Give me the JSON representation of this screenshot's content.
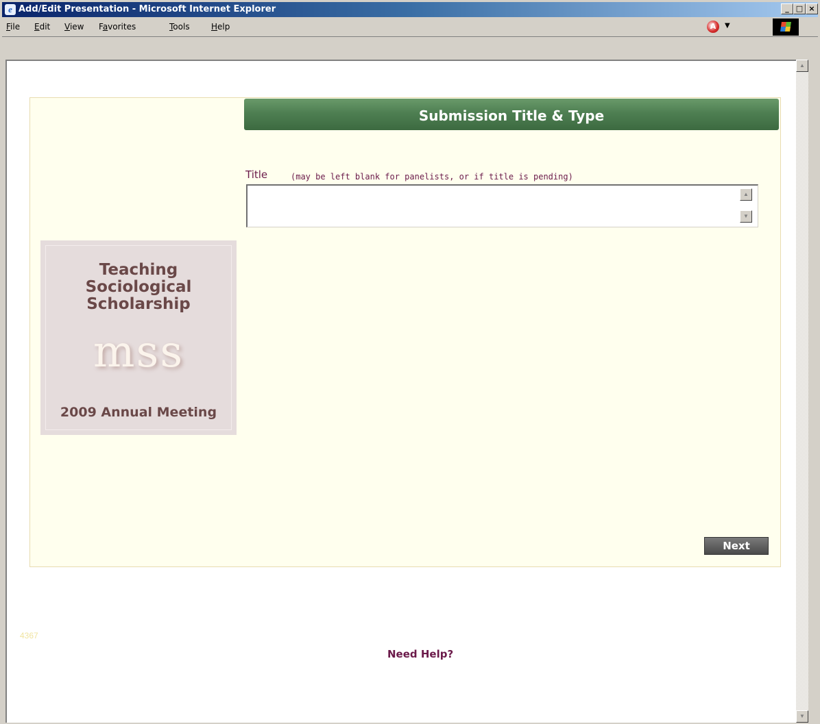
{
  "window": {
    "title": "Add/Edit Presentation - Microsoft Internet Explorer",
    "controls": {
      "minimize": "_",
      "maximize": "□",
      "close": "×"
    }
  },
  "menubar": {
    "items": [
      {
        "label": "File",
        "underline": "F",
        "rest": "ile"
      },
      {
        "label": "Edit",
        "underline": "E",
        "rest": "dit"
      },
      {
        "label": "View",
        "underline": "V",
        "rest": "iew"
      },
      {
        "label": "Favorites",
        "pre": "F",
        "underline": "a",
        "rest": "vorites"
      },
      {
        "label": "Tools",
        "underline": "T",
        "rest": "ools"
      },
      {
        "label": "Help",
        "underline": "H",
        "rest": "elp"
      }
    ]
  },
  "page": {
    "section_title": "Submission Title & Type",
    "title_field": {
      "label": "Title",
      "hint": "(may be left blank for panelists, or if title is pending)",
      "value": ""
    },
    "logo": {
      "line1": "Teaching",
      "line2": "Sociological",
      "line3": "Scholarship",
      "mark": "mss",
      "meeting": "2009 Annual Meeting"
    },
    "next_label": "Next",
    "page_id": "4367",
    "help_label": "Need Help?"
  },
  "colors": {
    "header_green": "#4e7f52",
    "panel_bg": "#ffffee",
    "accent_text": "#6b1a4a"
  }
}
